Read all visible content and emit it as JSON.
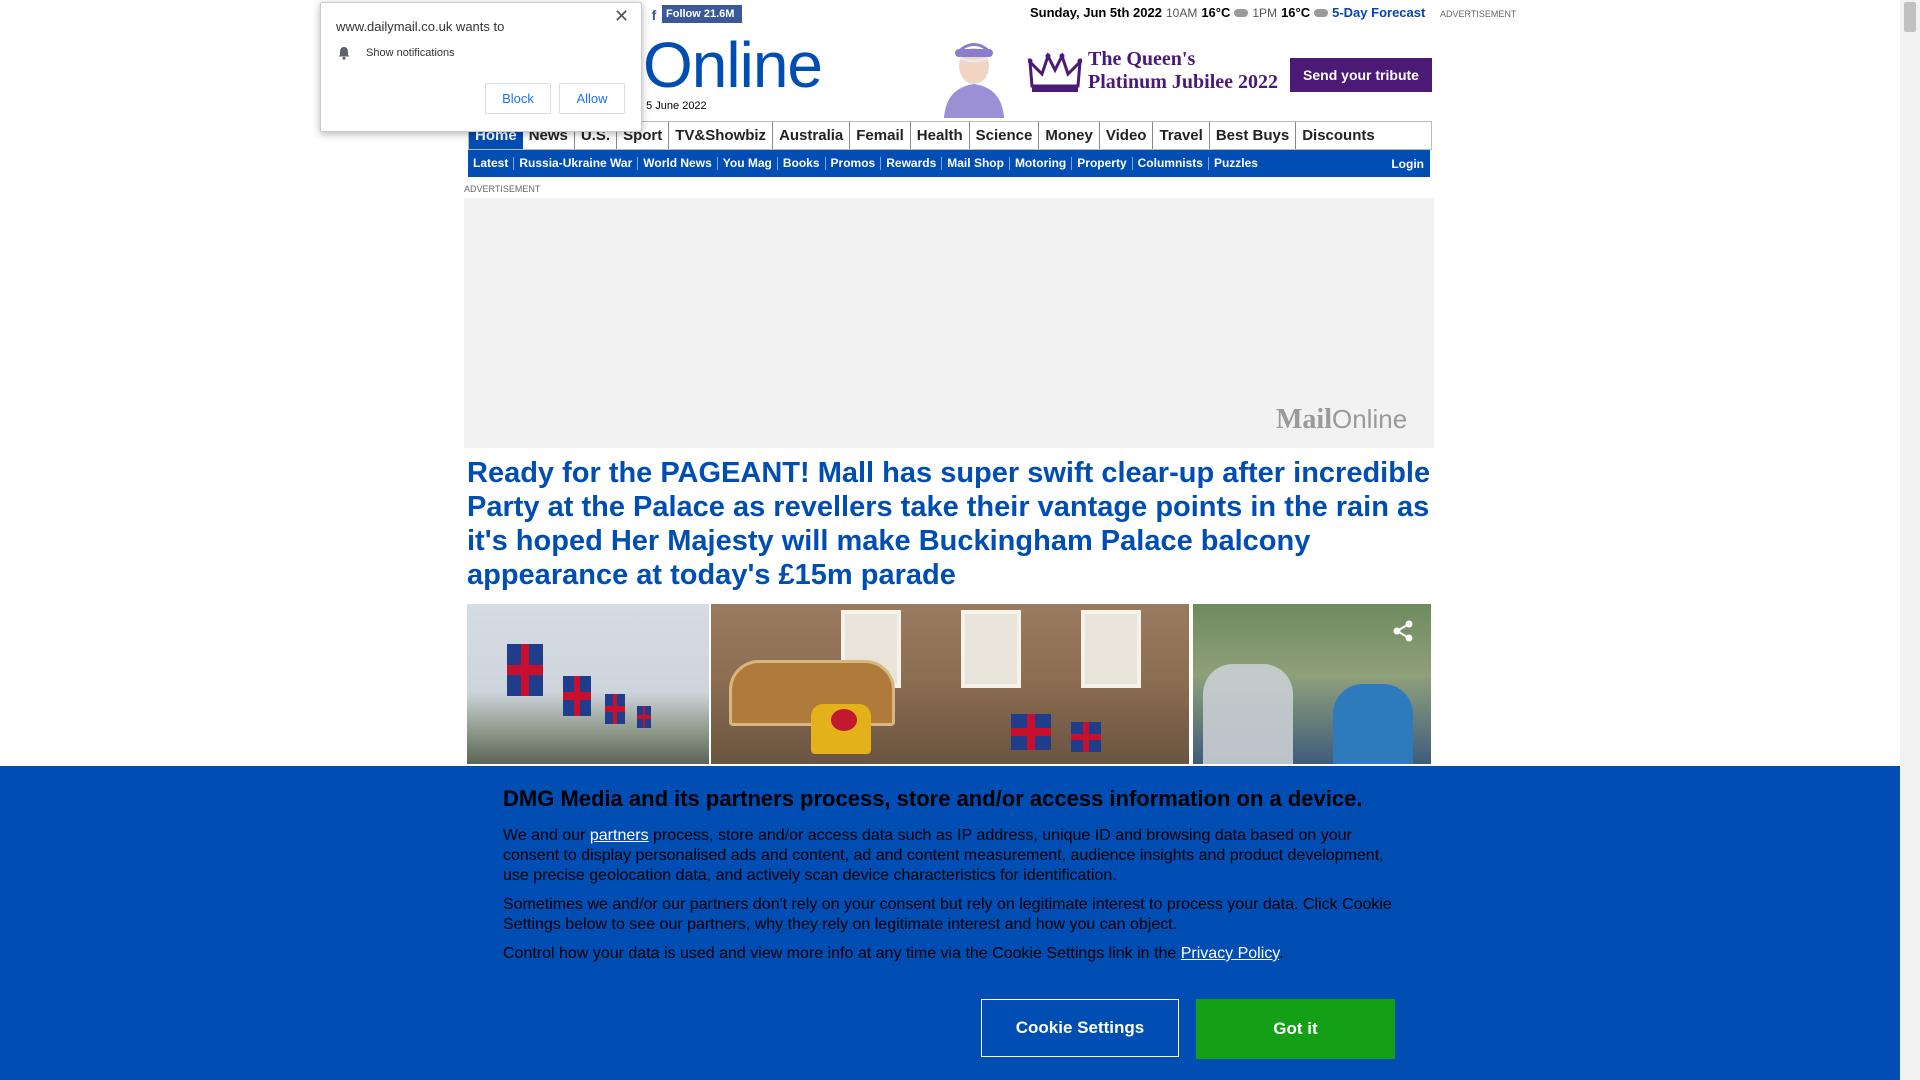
{
  "top_bar": {
    "facebook_follow": "Follow 21.6M",
    "weather": {
      "date": "Sunday, Jun 5th 2022",
      "slot1_time": "10AM",
      "slot1_temp": "16°C",
      "slot2_time": "1PM",
      "slot2_temp": "16°C",
      "forecast_link": "5-Day Forecast"
    },
    "advertisement_label": "ADVERTISEMENT"
  },
  "masthead": {
    "logo_text": "Online",
    "issue_date": ", 5 June 2022"
  },
  "jubilee_banner": {
    "line1": "The Queen's",
    "line2": "Platinum Jubilee 2022",
    "button": "Send your tribute"
  },
  "nav": {
    "primary": [
      "Home",
      "News",
      "U.S.",
      "Sport",
      "TV&Showbiz",
      "Australia",
      "Femail",
      "Health",
      "Science",
      "Money",
      "Video",
      "Travel",
      "Best Buys",
      "Discounts"
    ],
    "secondary": [
      "Latest",
      "Russia-Ukraine War",
      "World News",
      "You Mag",
      "Books",
      "Promos",
      "Rewards",
      "Mail Shop",
      "Motoring",
      "Property",
      "Columnists",
      "Puzzles"
    ],
    "login": "Login"
  },
  "ad": {
    "label": "ADVERTISEMENT",
    "logo_mail": "Mail",
    "logo_online": "Online"
  },
  "article": {
    "headline": "Ready for the PAGEANT! Mall has super swift clear-up after incredible Party at the Palace as revellers take their vantage points in the rain as it's hoped Her Majesty will make Buckingham Palace balcony appearance at today's £15m parade"
  },
  "cookie_banner": {
    "title": "DMG Media and its partners process, store and/or access information on a device.",
    "p1_before": "We and our ",
    "p1_link": "partners",
    "p1_after": " process, store and/or access data such as IP address, unique ID and browsing data based on your consent to display personalised ads and content, ad and content measurement, audience insights and product development, use precise geolocation data, and actively scan device characteristics for identification.",
    "p2": "Sometimes we and/or our partners don't rely on your consent but rely on legitimate interest to process your data. Click Cookie Settings below to see our partners, why they rely on legitimate interest and how you can object.",
    "p3_before": "Control how your data is used and view more info at any time via the Cookie Settings link in the ",
    "p3_link": "Privacy Policy",
    "p3_after": ".",
    "settings_button": "Cookie Settings",
    "accept_button": "Got it"
  },
  "notification_prompt": {
    "site": "www.dailymail.co.uk wants to",
    "permission": "Show notifications",
    "block": "Block",
    "allow": "Allow"
  },
  "icons": {
    "share": "share-icon",
    "bell": "bell-icon",
    "close": "close-icon",
    "facebook": "facebook-icon",
    "cloud": "cloud-icon"
  },
  "colors": {
    "brand_blue": "#004db3",
    "jubilee_purple": "#4a1a76",
    "accept_green": "#13a016",
    "facebook_blue": "#3b5998"
  }
}
